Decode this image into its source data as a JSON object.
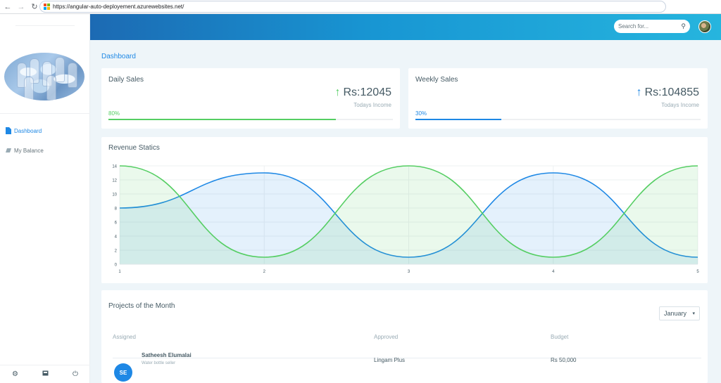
{
  "browser": {
    "url": "https://angular-auto-deployement.azurewebsites.net/",
    "back_icon": "arrow-left-icon",
    "forward_icon": "arrow-right-icon",
    "reload_icon": "reload-icon"
  },
  "sidebar": {
    "items": [
      {
        "label": "Dashboard",
        "icon": "document-icon",
        "active": true
      },
      {
        "label": "My Balance",
        "icon": "wallet-icon",
        "active": false
      }
    ],
    "footer_icons": [
      "gear-icon",
      "mail-icon",
      "power-icon"
    ]
  },
  "topbar": {
    "search_placeholder": "Search for...",
    "search_icon": "search-icon"
  },
  "page": {
    "title": "Dashboard"
  },
  "daily": {
    "title": "Daily Sales",
    "value": "Rs:12045",
    "sub": "Todays Income",
    "percent_label": "80%",
    "progress": 80,
    "color": "#55ce63"
  },
  "weekly": {
    "title": "Weekly Sales",
    "value": "Rs:104855",
    "sub": "Todays Income",
    "percent_label": "30%",
    "progress": 30,
    "color": "#1e88e5"
  },
  "revenue": {
    "title": "Revenue Statics"
  },
  "chart_data": {
    "type": "area",
    "title": "Revenue Statics",
    "x": [
      1,
      2,
      3,
      4,
      5
    ],
    "xticks": [
      "1",
      "2",
      "3",
      "4",
      "5"
    ],
    "yticks": [
      "0",
      "2",
      "4",
      "6",
      "8",
      "10",
      "12",
      "14"
    ],
    "ylim": [
      0,
      14
    ],
    "grid": true,
    "series": [
      {
        "values": [
          8,
          13,
          1,
          13,
          1
        ],
        "color": "#1e88e5"
      },
      {
        "values": [
          14,
          1,
          14,
          1,
          14
        ],
        "color": "#55ce63"
      }
    ]
  },
  "projects": {
    "title": "Projects of the Month",
    "month": "January",
    "columns": [
      "Assigned",
      "Approved",
      "Budget"
    ],
    "rows": [
      {
        "initials": "SE",
        "name": "Satheesh Elumalai",
        "role": "Water bottle seller",
        "approved": "Lingam Plus",
        "budget": "Rs 50,000"
      }
    ]
  }
}
